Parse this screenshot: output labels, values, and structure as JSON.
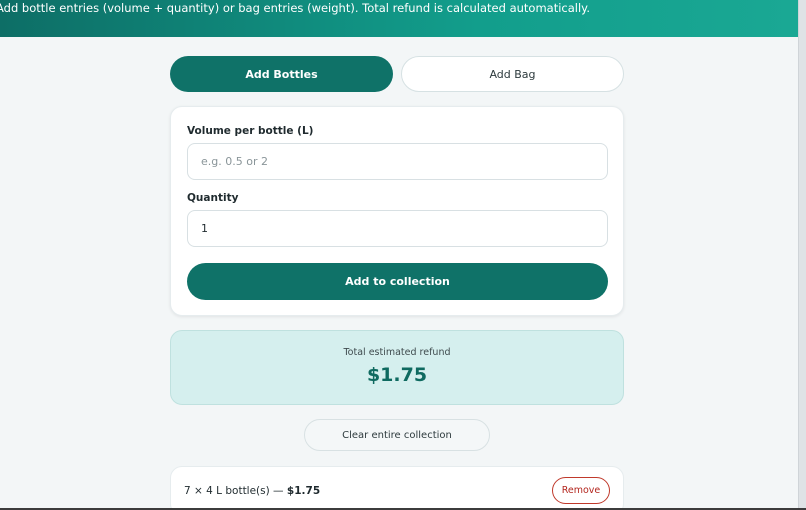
{
  "header": {
    "instructions": "Add bottle entries (volume + quantity) or bag entries (weight). Total refund is calculated automatically."
  },
  "tabs": [
    {
      "label": "Add Bottles",
      "active": true
    },
    {
      "label": "Add Bag",
      "active": false
    }
  ],
  "form": {
    "volume_label": "Volume per bottle (L)",
    "volume_placeholder": "e.g. 0.5 or 2",
    "volume_value": "",
    "quantity_label": "Quantity",
    "quantity_value": "1",
    "submit_label": "Add to collection"
  },
  "refund": {
    "label": "Total estimated refund",
    "value": "$1.75"
  },
  "clear_label": "Clear entire collection",
  "entries": [
    {
      "description": "7 × 4 L bottle(s) — ",
      "amount": "$1.75",
      "remove_label": "Remove"
    }
  ],
  "colors": {
    "accent": "#0f7268",
    "refund_bg": "#d5efee",
    "remove": "#b3261e"
  }
}
